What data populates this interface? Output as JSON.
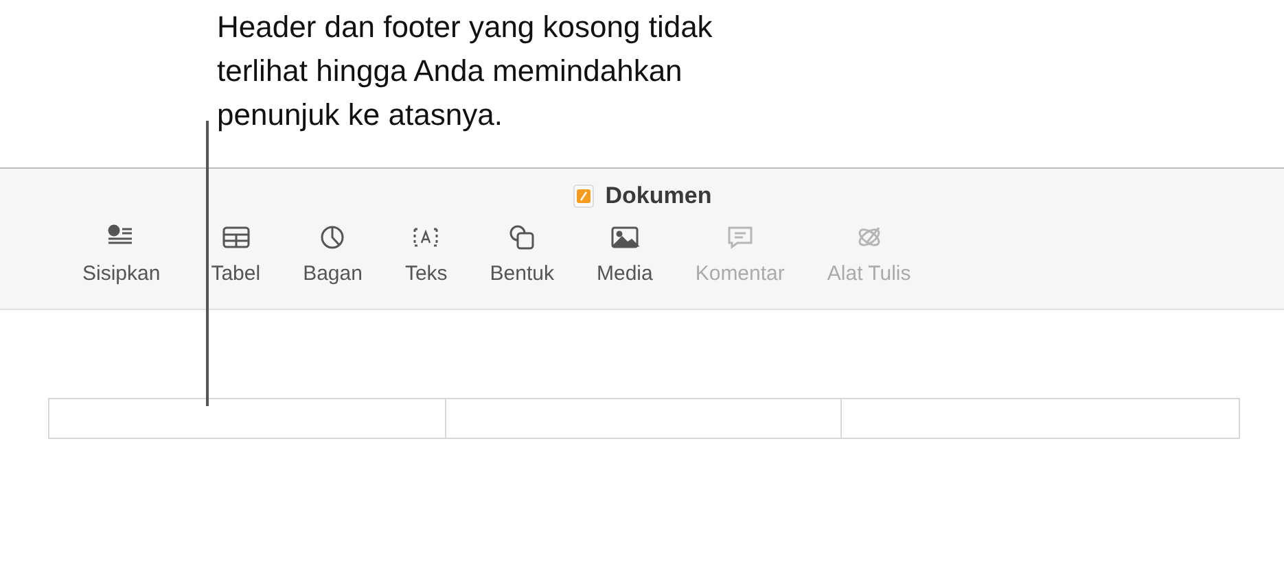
{
  "callout": {
    "text": "Header dan footer yang kosong tidak terlihat hingga Anda memindahkan penunjuk ke atasnya."
  },
  "window": {
    "title": "Dokumen"
  },
  "toolbar": [
    {
      "label": "Sisipkan",
      "kind": "insert",
      "disabled": false
    },
    {
      "label": "Tabel",
      "kind": "table",
      "disabled": false
    },
    {
      "label": "Bagan",
      "kind": "chart",
      "disabled": false
    },
    {
      "label": "Teks",
      "kind": "text",
      "disabled": false
    },
    {
      "label": "Bentuk",
      "kind": "shape",
      "disabled": false
    },
    {
      "label": "Media",
      "kind": "media",
      "disabled": false
    },
    {
      "label": "Komentar",
      "kind": "comment",
      "disabled": true
    },
    {
      "label": "Alat Tulis",
      "kind": "pen",
      "disabled": true
    }
  ]
}
